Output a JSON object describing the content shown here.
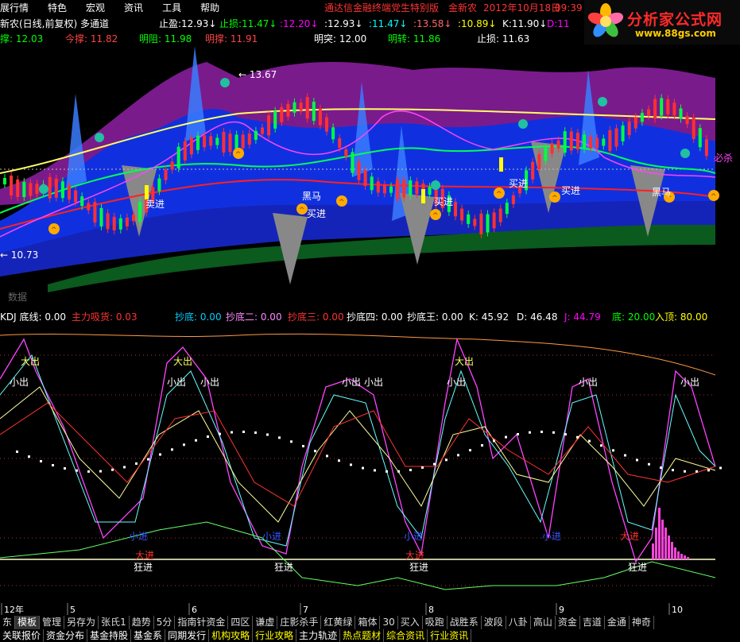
{
  "menu": [
    "展行情",
    "特色",
    "宏观",
    "资讯",
    "工具",
    "帮助"
  ],
  "title_center": "通达信金融终端党生特别版",
  "title_user": "金新农",
  "title_date": "2012年10月18日",
  "title_time": "09:39",
  "logo": {
    "text": "分析家公式网",
    "url": "www.88gs.com"
  },
  "main_header": {
    "name": "新农(日线,前复权) 多通道",
    "items": [
      {
        "label": "止盈:",
        "value": "12.93",
        "arrow": "↓",
        "color": "#ffffff"
      },
      {
        "label": "止损:",
        "value": "11.47",
        "arrow": "↓",
        "color": "#00ff00"
      },
      {
        "label": ":",
        "value": "12.20",
        "arrow": "↓",
        "color": "#ff00ff"
      },
      {
        "label": ":",
        "value": "12.93",
        "arrow": "↓",
        "color": "#ffffff"
      },
      {
        "label": ":",
        "value": "11.47",
        "arrow": "↓",
        "color": "#00ffff"
      },
      {
        "label": ":",
        "value": "13.58",
        "arrow": "↓",
        "color": "#ff6666"
      },
      {
        "label": ":",
        "value": "10.89",
        "arrow": "↓",
        "color": "#ffff00"
      },
      {
        "label": "K:",
        "value": "11.90",
        "arrow": "↓",
        "color": "#ffffff"
      },
      {
        "label": "D:",
        "value": "11",
        "arrow": "",
        "color": "#ff00ff"
      }
    ]
  },
  "main_header2": [
    {
      "label": "撑:",
      "value": "12.03",
      "color": "#00ff00"
    },
    {
      "label": "今撑:",
      "value": "11.82",
      "color": "#ff4444"
    },
    {
      "label": "明阻:",
      "value": "11.98",
      "color": "#00ff00"
    },
    {
      "label": "明撑:",
      "value": "11.91",
      "color": "#ff4444"
    },
    {
      "label": "明突:",
      "value": "12.00",
      "color": "#ffffff"
    },
    {
      "label": "明转:",
      "value": "11.86",
      "color": "#00ff00"
    },
    {
      "label": "止损:",
      "value": "11.63",
      "color": "#ffffff"
    }
  ],
  "main_chart": {
    "high_label": "13.67",
    "low_label": "10.73",
    "right_label": "必杀",
    "bottom_label": "数据",
    "signals": [
      "卖进",
      "买进",
      "黑马",
      "买进",
      "买进",
      "买进",
      "买进",
      "买进",
      "买进",
      "黑马"
    ]
  },
  "kdj_header": [
    {
      "label": "KDJ 底线:",
      "value": "0.00",
      "color": "#ffffff"
    },
    {
      "label": "主力吸货:",
      "value": "0.03",
      "color": "#ff3333"
    },
    {
      "label": "抄底:",
      "value": "0.00",
      "color": "#00ccff"
    },
    {
      "label": "抄底二:",
      "value": "0.00",
      "color": "#ff88ff"
    },
    {
      "label": "抄底三:",
      "value": "0.00",
      "color": "#ff3333"
    },
    {
      "label": "抄底四:",
      "value": "0.00",
      "color": "#ffffff"
    },
    {
      "label": "抄底王:",
      "value": "0.00",
      "color": "#ffffff"
    },
    {
      "label": "K:",
      "value": "45.92",
      "color": "#ffffff"
    },
    {
      "label": "D:",
      "value": "46.48",
      "color": "#ffffff"
    },
    {
      "label": "J:",
      "value": "44.79",
      "color": "#ff00ff"
    },
    {
      "label": "底:",
      "value": "20.00",
      "color": "#00ff00"
    },
    {
      "label": "入顶:",
      "value": "80.00",
      "color": "#ffff00"
    }
  ],
  "kdj_labels": {
    "big_out": "大出",
    "small_out": "小出",
    "buy": "狂进",
    "small_buy": "小进",
    "dan": "大进"
  },
  "x_axis": [
    "12年",
    "5",
    "6",
    "7",
    "8",
    "9",
    "10"
  ],
  "tabs": [
    "东",
    "模板",
    "管理",
    "另存为",
    "张氏1",
    "趋势",
    "5分",
    "指南针资金",
    "四区",
    "谦虚",
    "庄影杀手",
    "红黄绿",
    "箱体",
    "30",
    "买入",
    "吸跑",
    "战胜系",
    "波段",
    "八卦",
    "高山",
    "资金",
    "吉道",
    "金通",
    "神奇"
  ],
  "subtabs": [
    {
      "label": "关联报价",
      "color": "#ffffff"
    },
    {
      "label": "资金分布",
      "color": "#ffffff"
    },
    {
      "label": "基金持股",
      "color": "#ffffff"
    },
    {
      "label": "基金系",
      "color": "#ffffff"
    },
    {
      "label": "同期发行",
      "color": "#ffffff"
    },
    {
      "label": "机构攻略",
      "color": "#ffff00"
    },
    {
      "label": "行业攻略",
      "color": "#ffff00"
    },
    {
      "label": "主力轨迹",
      "color": "#ffffff"
    },
    {
      "label": "热点题材",
      "color": "#ffff00"
    },
    {
      "label": "综合资讯",
      "color": "#ffff00"
    },
    {
      "label": "行业资讯",
      "color": "#ffff00"
    }
  ]
}
